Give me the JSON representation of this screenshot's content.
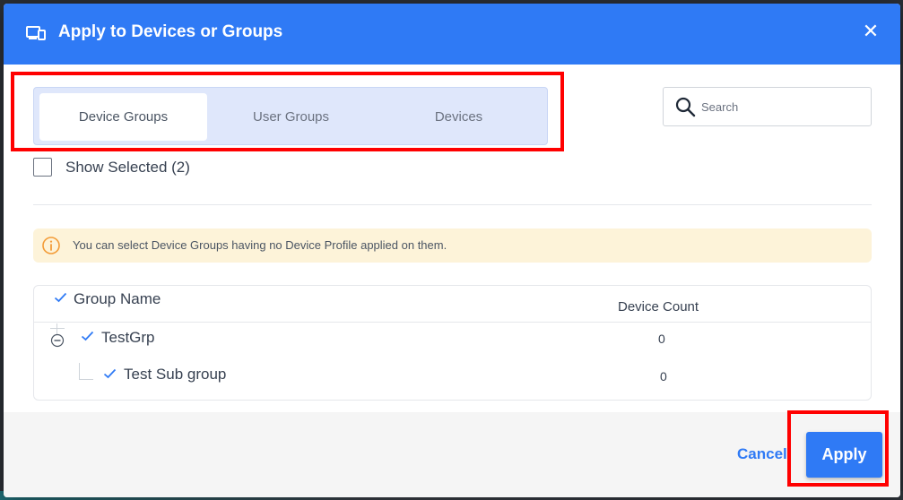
{
  "dialog": {
    "title": "Apply to Devices or Groups",
    "close_glyph": "✕",
    "header_icon": "devices-icon",
    "accent_color": "#2f7af5"
  },
  "tabs": [
    {
      "label": "Device Groups",
      "active": true
    },
    {
      "label": "User Groups",
      "active": false
    },
    {
      "label": "Devices",
      "active": false
    }
  ],
  "search": {
    "placeholder": "Search",
    "value": ""
  },
  "show_selected": {
    "label": "Show Selected (2)",
    "checked": false
  },
  "info": {
    "text": "You can select Device Groups having no Device Profile applied on them.",
    "icon": "info-icon"
  },
  "table": {
    "columns": {
      "group_name": "Group Name",
      "device_count": "Device Count"
    },
    "rows": [
      {
        "name": "TestGrp",
        "count": "0",
        "level": 0,
        "selected": true
      },
      {
        "name": "Test Sub group",
        "count": "0",
        "level": 1,
        "selected": true
      }
    ]
  },
  "footer": {
    "cancel_label": "Cancel",
    "apply_label": "Apply"
  }
}
